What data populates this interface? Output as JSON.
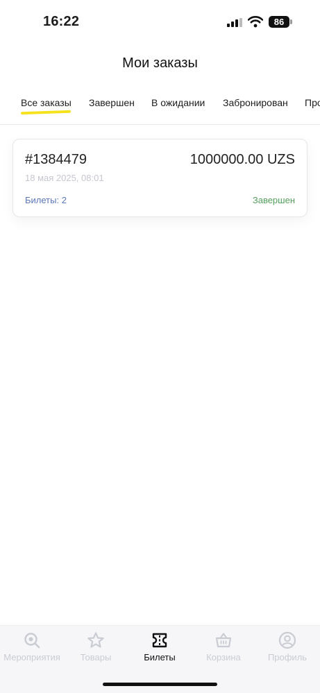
{
  "status_bar": {
    "time": "16:22",
    "battery": "86",
    "icons": [
      "cellular-signal-icon",
      "wifi-icon",
      "battery-icon"
    ]
  },
  "header": {
    "title": "Мои заказы"
  },
  "tabs": [
    {
      "label": "Все заказы",
      "active": true
    },
    {
      "label": "Завершен"
    },
    {
      "label": "В ожидании"
    },
    {
      "label": "Забронирован"
    },
    {
      "label": "Про"
    }
  ],
  "colors": {
    "accent_indicator": "#f5e21c",
    "status_completed": "#56a05e",
    "tickets_link": "#5b78b8",
    "inactive_nav": "#c9ccd3"
  },
  "orders": [
    {
      "id": "#1384479",
      "price": "1000000.00 UZS",
      "date": "18 мая 2025, 08:01",
      "tickets": "Билеты: 2",
      "status": "Завершен"
    }
  ],
  "bottom_nav": [
    {
      "label": "Мероприятия",
      "icon": "search-icon"
    },
    {
      "label": "Товары",
      "icon": "star-icon"
    },
    {
      "label": "Билеты",
      "icon": "ticket-icon",
      "active": true
    },
    {
      "label": "Корзина",
      "icon": "basket-icon"
    },
    {
      "label": "Профиль",
      "icon": "profile-icon"
    }
  ]
}
